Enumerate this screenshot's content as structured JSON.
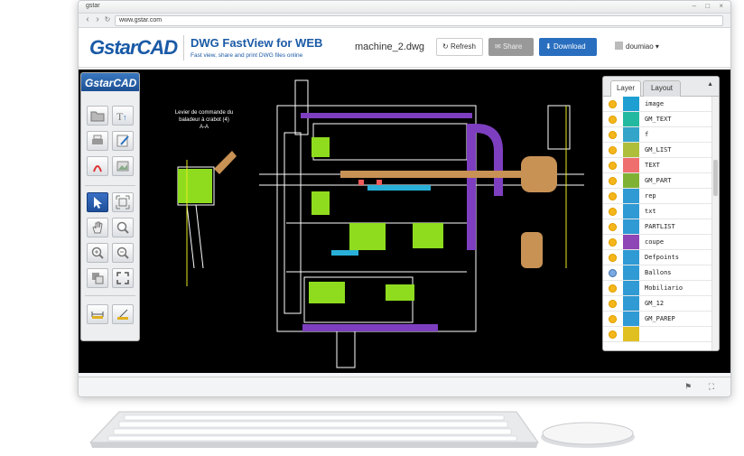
{
  "browser": {
    "tab_title": "gstar",
    "url": "www.gstar.com",
    "window_controls": "– □ ×"
  },
  "app": {
    "logo_text_g": "Gstar",
    "logo_text_cad": "CAD",
    "title": "DWG FastView for WEB",
    "subtitle": "Fast view, share and print DWG files online",
    "file_name": "machine_2.dwg",
    "refresh_label": "Refresh",
    "share_label": "Share",
    "download_label": "Download",
    "user_name": "doumiao",
    "user_caret": "▾"
  },
  "toolbar": {
    "logo": "GstarCAD"
  },
  "drawing": {
    "annotation_line1": "Levier de commande du",
    "annotation_line2": "baladeur à crabot (4)",
    "annotation_line3": "A-A"
  },
  "layer_panel": {
    "tab_layer": "Layer",
    "tab_layout": "Layout",
    "collapse": "▲",
    "layers": [
      {
        "name": "image",
        "color": "#1e9fd2",
        "on": true
      },
      {
        "name": "GM_TEXT",
        "color": "#23b9a0",
        "on": true
      },
      {
        "name": "f",
        "color": "#34a4c9",
        "on": true
      },
      {
        "name": "GM_LIST",
        "color": "#aebe3a",
        "on": true
      },
      {
        "name": "TEXT",
        "color": "#ef6f6f",
        "on": true
      },
      {
        "name": "GM_PART",
        "color": "#7fb234",
        "on": true
      },
      {
        "name": "rep",
        "color": "#2f9ad4",
        "on": true
      },
      {
        "name": "txt",
        "color": "#2f9ad4",
        "on": true
      },
      {
        "name": "PARTLIST",
        "color": "#2f9ad4",
        "on": true
      },
      {
        "name": "coupe",
        "color": "#8e45b5",
        "on": true
      },
      {
        "name": "Defpoints",
        "color": "#2f9ad4",
        "on": true
      },
      {
        "name": "Ballons",
        "color": "#2f9ad4",
        "on": false
      },
      {
        "name": "Mobiliario",
        "color": "#2f9ad4",
        "on": true
      },
      {
        "name": "GM_12",
        "color": "#2f9ad4",
        "on": true
      },
      {
        "name": "GM_PAREP",
        "color": "#2f9ad4",
        "on": true
      },
      {
        "name": "",
        "color": "#e0c020",
        "on": true
      }
    ]
  },
  "statusbar": {
    "icons": "⚑ ⛶"
  },
  "colors": {
    "brand": "#1a5aa6",
    "download": "#2a6fbf",
    "canvas": "#000000"
  }
}
